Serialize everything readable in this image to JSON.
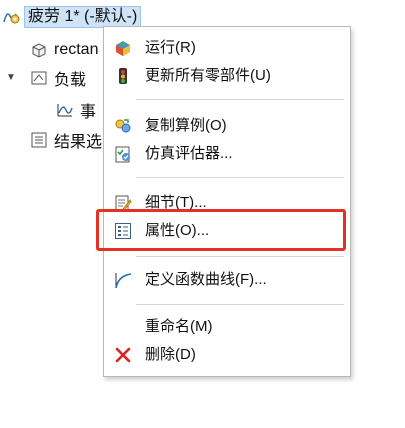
{
  "tree": {
    "root": {
      "label": "疲劳 1* (-默认-)"
    },
    "items": [
      {
        "label": "rectan"
      },
      {
        "label": "负载"
      },
      {
        "label": "事"
      },
      {
        "label": "结果选"
      }
    ]
  },
  "context_menu": {
    "items": [
      {
        "label": "运行(R)",
        "icon": "run-icon"
      },
      {
        "label": "更新所有零部件(U)",
        "icon": "traffic-light-icon"
      },
      {
        "label": "复制算例(O)",
        "icon": "copy-study-icon"
      },
      {
        "label": "仿真评估器...",
        "icon": "simulation-evaluator-icon"
      },
      {
        "label": "细节(T)...",
        "icon": "details-icon"
      },
      {
        "label": "属性(O)...",
        "icon": "properties-icon"
      },
      {
        "label": "定义函数曲线(F)...",
        "icon": "curve-icon"
      },
      {
        "label": "重命名(M)"
      },
      {
        "label": "删除(D)",
        "icon": "delete-icon"
      }
    ]
  },
  "colors": {
    "highlight_border": "#e53123",
    "selection_bg": "#cfe3f7"
  }
}
